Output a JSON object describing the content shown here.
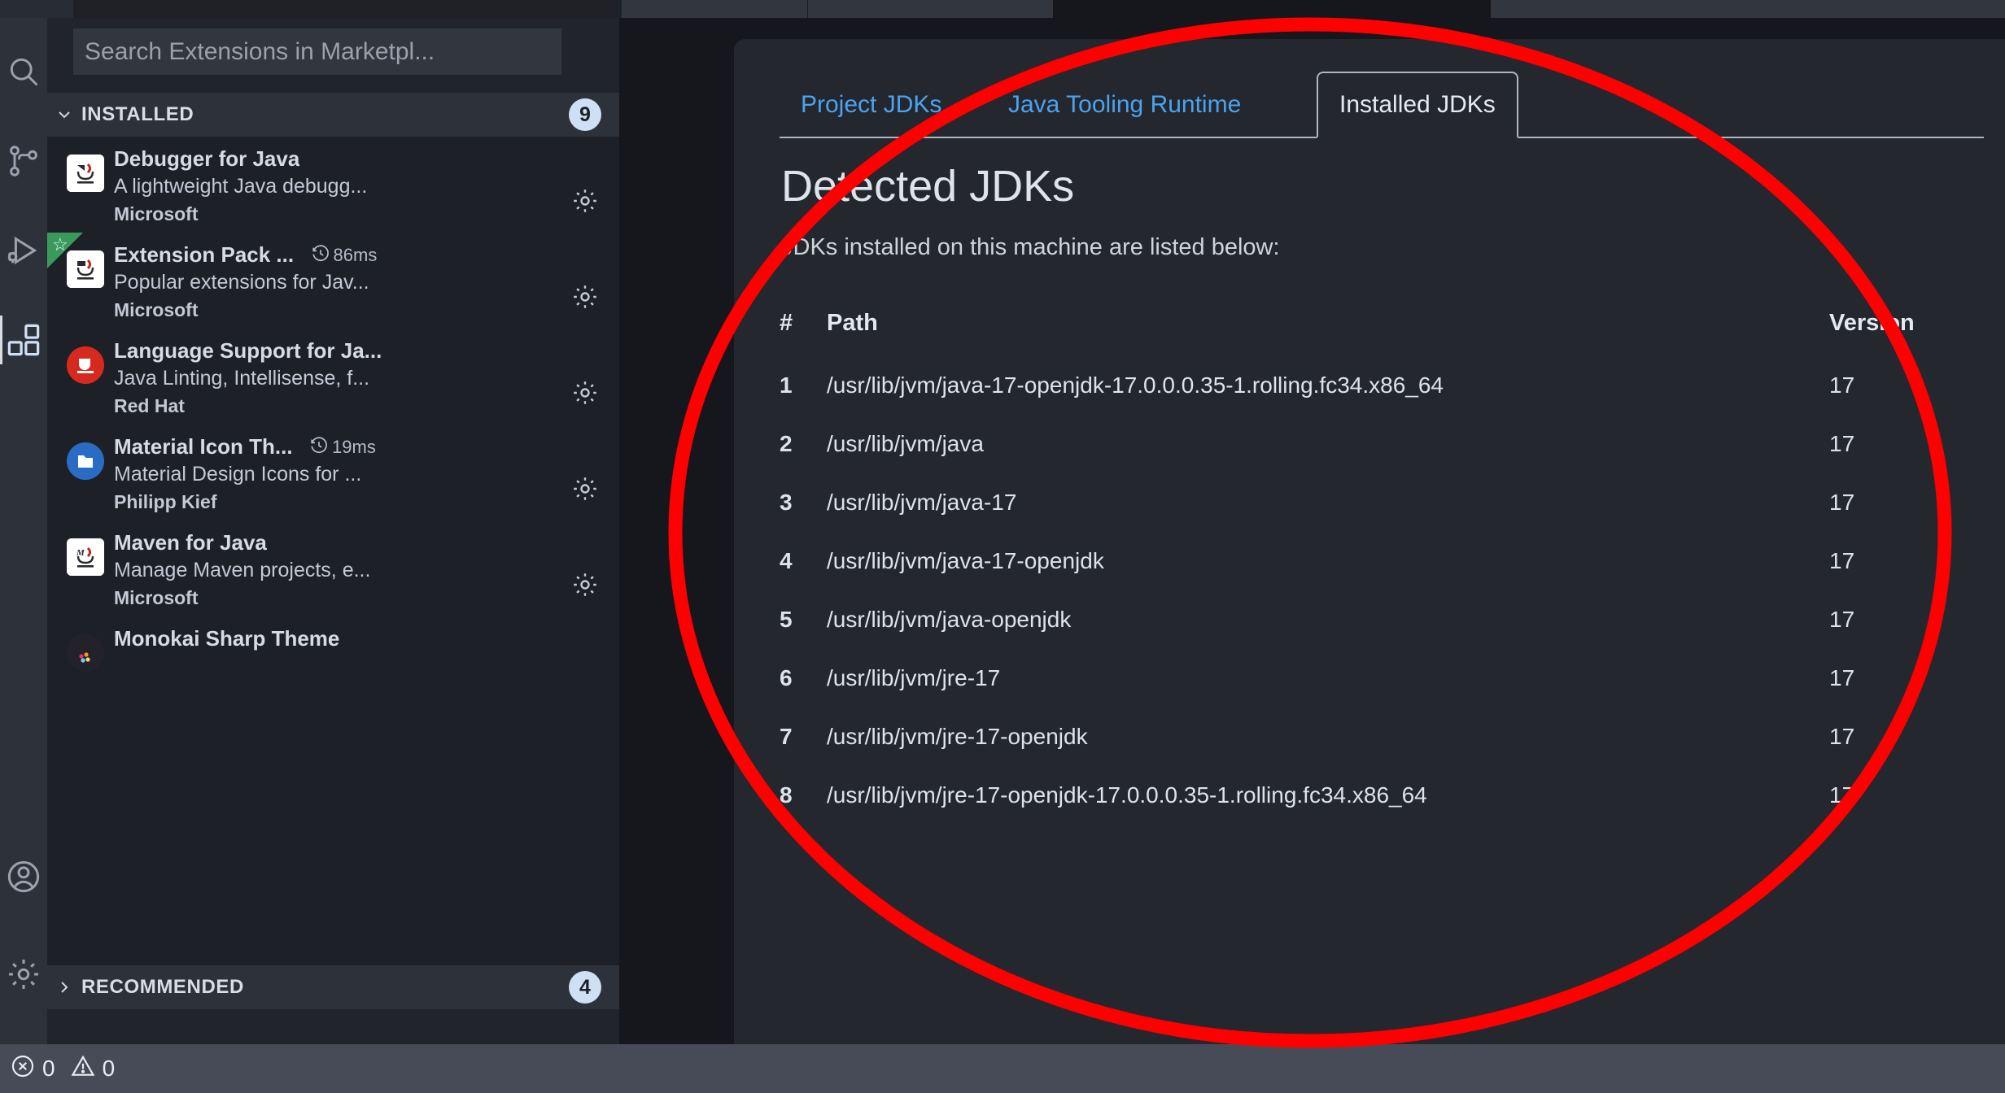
{
  "window": {
    "background": "#15171c",
    "accent_blue": "#4aa3f0",
    "annotation_color": "#ff0000"
  },
  "activity_bar": {
    "items": [
      {
        "name": "search-icon",
        "label": "Search"
      },
      {
        "name": "source-control-icon",
        "label": "Source Control"
      },
      {
        "name": "run-and-debug-icon",
        "label": "Run and Debug"
      },
      {
        "name": "extensions-icon",
        "label": "Extensions",
        "active": true
      }
    ],
    "bottom_items": [
      {
        "name": "account-icon",
        "label": "Accounts"
      },
      {
        "name": "manage-gear-icon",
        "label": "Manage"
      }
    ]
  },
  "sidebar": {
    "search": {
      "placeholder": "Search Extensions in Marketpl...",
      "value": ""
    },
    "sections": [
      {
        "title": "INSTALLED",
        "count": "9",
        "expanded": true
      },
      {
        "title": "RECOMMENDED",
        "count": "4",
        "expanded": false
      }
    ],
    "extensions": [
      {
        "name": "Debugger for Java",
        "description": "A lightweight Java debugg...",
        "publisher": "Microsoft",
        "activation_time": "",
        "icon": "java-debug-icon",
        "starred": false
      },
      {
        "name": "Extension Pack ...",
        "description": "Popular extensions for Jav...",
        "publisher": "Microsoft",
        "activation_time": "86ms",
        "icon": "java-pack-icon",
        "starred": true
      },
      {
        "name": "Language Support for Ja...",
        "description": "Java Linting, Intellisense, f...",
        "publisher": "Red Hat",
        "activation_time": "",
        "icon": "redhat-java-icon",
        "starred": false
      },
      {
        "name": "Material Icon Th...",
        "description": "Material Design Icons for ...",
        "publisher": "Philipp Kief",
        "activation_time": "19ms",
        "icon": "material-folder-icon",
        "starred": false
      },
      {
        "name": "Maven for Java",
        "description": "Manage Maven projects, e...",
        "publisher": "Microsoft",
        "activation_time": "",
        "icon": "maven-icon",
        "starred": false
      },
      {
        "name": "Monokai Sharp Theme",
        "description": "",
        "publisher": "",
        "activation_time": "",
        "icon": "monokai-icon",
        "starred": false
      }
    ]
  },
  "editor": {
    "webview": {
      "tabs": [
        {
          "label": "Project JDKs",
          "active": false
        },
        {
          "label": "Java Tooling Runtime",
          "active": false
        },
        {
          "label": "Installed JDKs",
          "active": true
        }
      ],
      "heading": "Detected JDKs",
      "subheading": "JDKs installed on this machine are listed below:",
      "table": {
        "columns": [
          "#",
          "Path",
          "Version"
        ],
        "rows": [
          {
            "num": "1",
            "path": "/usr/lib/jvm/java-17-openjdk-17.0.0.0.35-1.rolling.fc34.x86_64",
            "version": "17"
          },
          {
            "num": "2",
            "path": "/usr/lib/jvm/java",
            "version": "17"
          },
          {
            "num": "3",
            "path": "/usr/lib/jvm/java-17",
            "version": "17"
          },
          {
            "num": "4",
            "path": "/usr/lib/jvm/java-17-openjdk",
            "version": "17"
          },
          {
            "num": "5",
            "path": "/usr/lib/jvm/java-openjdk",
            "version": "17"
          },
          {
            "num": "6",
            "path": "/usr/lib/jvm/jre-17",
            "version": "17"
          },
          {
            "num": "7",
            "path": "/usr/lib/jvm/jre-17-openjdk",
            "version": "17"
          },
          {
            "num": "8",
            "path": "/usr/lib/jvm/jre-17-openjdk-17.0.0.0.35-1.rolling.fc34.x86_64",
            "version": "17"
          }
        ]
      }
    }
  },
  "status_bar": {
    "errors": "0",
    "warnings": "0"
  }
}
